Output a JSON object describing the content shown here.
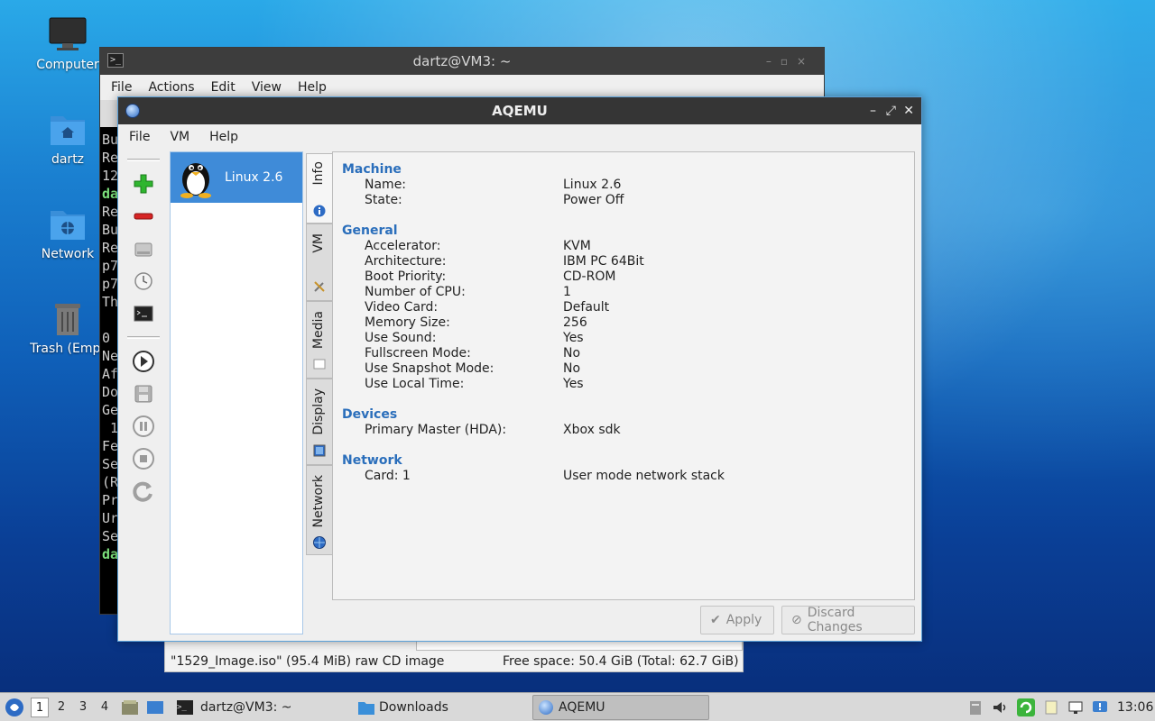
{
  "desktop": {
    "icons": [
      {
        "label": "Computer"
      },
      {
        "label": "dartz"
      },
      {
        "label": "Network"
      },
      {
        "label": "Trash (Empt"
      }
    ]
  },
  "terminal": {
    "title": "dartz@VM3: ~",
    "menu": [
      "File",
      "Actions",
      "Edit",
      "View",
      "Help"
    ],
    "lines": [
      "Bu",
      "Re",
      "12",
      "da",
      "Re",
      "Bu",
      "Re",
      "p7",
      "p7",
      "Th",
      "",
      "0",
      "Ne",
      "Af",
      "Do",
      "Ge",
      " 1",
      "Fe",
      "Se",
      "(R",
      "Pr",
      "Ur",
      "Se",
      "da"
    ]
  },
  "filemanager": {
    "status_left": "\"1529_Image.iso\" (95.4 MiB) raw CD image",
    "status_right": "Free space: 50.4 GiB (Total: 62.7 GiB)"
  },
  "aqemu": {
    "title": "AQEMU",
    "menu": [
      "File",
      "VM",
      "Help"
    ],
    "vm_list": [
      {
        "name": "Linux 2.6"
      }
    ],
    "tabs": [
      "Info",
      "VM",
      "Media",
      "Display",
      "Network"
    ],
    "sections": {
      "machine": {
        "heading": "Machine",
        "rows": [
          [
            "Name:",
            "Linux 2.6"
          ],
          [
            "State:",
            "Power Off"
          ]
        ]
      },
      "general": {
        "heading": "General",
        "rows": [
          [
            "Accelerator:",
            "KVM"
          ],
          [
            "Architecture:",
            "IBM PC 64Bit"
          ],
          [
            "Boot Priority:",
            "CD-ROM"
          ],
          [
            "Number of CPU:",
            "1"
          ],
          [
            "Video Card:",
            "Default"
          ],
          [
            "Memory Size:",
            "256"
          ],
          [
            "Use Sound:",
            "Yes"
          ],
          [
            "Fullscreen Mode:",
            "No"
          ],
          [
            "Use Snapshot Mode:",
            "No"
          ],
          [
            "Use Local Time:",
            "Yes"
          ]
        ]
      },
      "devices": {
        "heading": "Devices",
        "rows": [
          [
            "Primary Master (HDA):",
            "Xbox sdk"
          ]
        ]
      },
      "network": {
        "heading": "Network",
        "rows": [
          [
            "Card: 1",
            "User mode network stack"
          ]
        ]
      }
    },
    "apply_label": "Apply",
    "discard_label": "Discard Changes"
  },
  "taskbar": {
    "workspaces": [
      "1",
      "2",
      "3",
      "4"
    ],
    "tasks": [
      {
        "label": "dartz@VM3: ~"
      },
      {
        "label": "Downloads"
      },
      {
        "label": "AQEMU"
      }
    ],
    "clock": "13:06"
  },
  "colors": {
    "accent": "#3f8bd8",
    "section_heading": "#2a6ebb",
    "terminal_prompt": "#7ce07c"
  }
}
